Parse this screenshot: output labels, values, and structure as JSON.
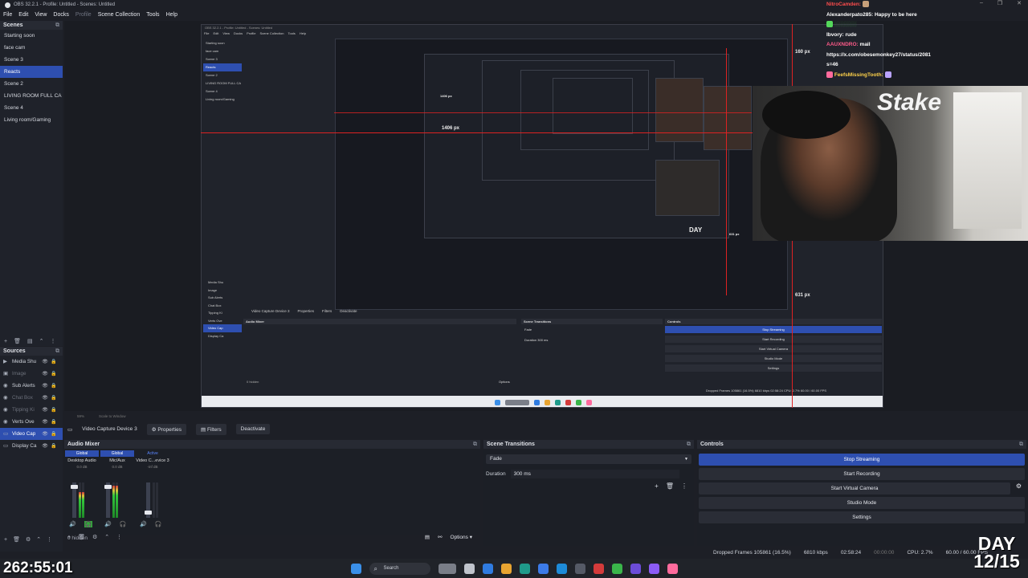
{
  "window": {
    "title": "OBS 32.2.1 - Profile: Untitled - Scenes: Untitled",
    "controls": [
      "–",
      "❐",
      "✕"
    ]
  },
  "menu": {
    "items": [
      "File",
      "Edit",
      "View",
      "Docks",
      "Profile",
      "Scene Collection",
      "Tools",
      "Help"
    ]
  },
  "scenes": {
    "title": "Scenes",
    "items": [
      "Starting soon",
      "face cam",
      "Scene 3",
      "Reacts",
      "Scene 2",
      "LIVING ROOM FULL CA",
      "Scene 4",
      "Living room/Gaming"
    ],
    "active_index": 3
  },
  "sources": {
    "title": "Sources",
    "items": [
      {
        "label": "Media Shu",
        "icon": "▶"
      },
      {
        "label": "Image",
        "icon": "▣"
      },
      {
        "label": "Sub Alerts",
        "icon": "◉"
      },
      {
        "label": "Chat Box",
        "icon": "◉"
      },
      {
        "label": "Tipping Ki",
        "icon": "◉"
      },
      {
        "label": "Verts Ove",
        "icon": "◉"
      },
      {
        "label": "Video Cap",
        "icon": "▭"
      },
      {
        "label": "Display Ca",
        "icon": "▭"
      }
    ],
    "hidden_label": "0 hidden"
  },
  "chat": {
    "messages": [
      {
        "user": "NitroCamden:",
        "text": "",
        "color": "user-red"
      },
      {
        "user": "Alexanderpato285:",
        "text": " Happy to be here",
        "color": "user-white"
      },
      {
        "user": "",
        "text": "",
        "color": "user-green"
      },
      {
        "user": "Ibvory:",
        "text": " rude",
        "color": "user-white"
      },
      {
        "user": "AAUXNDRO:",
        "text": " mail",
        "color": "user-pink"
      },
      {
        "user": "",
        "text": "https://x.com/obesemonkey27/status/2081",
        "color": "user-white"
      },
      {
        "user": "",
        "text": "s=46",
        "color": "user-white"
      },
      {
        "user": "FeefsMissingTooth:",
        "text": "",
        "color": "user-yellow"
      }
    ]
  },
  "webcam": {
    "brand": "Stake"
  },
  "nested": {
    "title": "OBS 32.2.1 - Profile: Untitled - Scenes: Untitled",
    "menu": [
      "File",
      "Edit",
      "View",
      "Docks",
      "Profile",
      "Scene Collection",
      "Tools",
      "Help"
    ],
    "scenes": [
      "Starting soon",
      "face cam",
      "Scene 3",
      "Reacts",
      "Scene 2",
      "LIVING ROOM FULL CA",
      "Scene 4",
      "Living room/Gaming"
    ],
    "sources": [
      "Media Shu",
      "Image",
      "Sub Alerts",
      "Chat Box",
      "Tipping Ki",
      "Verts Ove",
      "Video Cap",
      "Display Ca"
    ],
    "device_label": "Video Capture Device 3",
    "properties": "Properties",
    "filters": "Filters",
    "deactivate": "Deactivate",
    "audio_mixer": "Audio Mixer",
    "scene_transitions": "Scene Transitions",
    "controls": "Controls",
    "fade": "Fade",
    "duration": "Duration",
    "duration_value": "300 ms",
    "stop_streaming": "Stop Streaming",
    "start_recording": "Start Recording",
    "start_virtual_camera": "Start Virtual Camera",
    "studio_mode": "Studio Mode",
    "settings": "Settings",
    "hidden": "0 hidden",
    "options": "Options",
    "status": "Dropped Frames 105861 (16.5%)   6810 kbps   02:58:24   CPU: 2.7%   60.00 / 60.00 FPS",
    "measure_top": "160 px",
    "measure_left": "1406 px",
    "measure_right": "631 px",
    "inner_measure_left": "1406 px",
    "inner_measure_right": "631 px",
    "day_small": "DAY"
  },
  "below_preview": {
    "zoom": "59%",
    "scale": "Scale to Window"
  },
  "source_toolbar": {
    "device": "Video Capture Device 3",
    "properties": "Properties",
    "filters": "Filters",
    "deactivate": "Deactivate"
  },
  "audio_mixer": {
    "title": "Audio Mixer",
    "channels": [
      {
        "name": "Desktop Audio",
        "db": "0.0 dB",
        "tag": "Global",
        "level": 0.72
      },
      {
        "name": "Mic/Aux",
        "db": "0.0 dB",
        "tag": "Global",
        "level": 0.9
      },
      {
        "name": "Video C...evice 3",
        "db": "-inf dB",
        "tag": "Active",
        "level": 0.0
      }
    ],
    "options_label": "Options"
  },
  "scene_transitions": {
    "title": "Scene Transitions",
    "transition": "Fade",
    "duration_label": "Duration",
    "duration_value": "300 ms"
  },
  "controls": {
    "title": "Controls",
    "stop_streaming": "Stop Streaming",
    "start_recording": "Start Recording",
    "start_virtual_camera": "Start Virtual Camera",
    "studio_mode": "Studio Mode",
    "settings": "Settings"
  },
  "status": {
    "dropped_frames": "Dropped Frames 105861 (16.5%)",
    "bitrate": "6810 kbps",
    "stream_time": "02:58:24",
    "rec_time": "00:00:00",
    "cpu": "CPU: 2.7%",
    "fps": "60.00 / 60.00 FPS"
  },
  "taskbar": {
    "search": "Search",
    "icon_colors": [
      "#3a8fe8",
      "#7a7e88",
      "#c0c4cc",
      "#2f7be0",
      "#e8a431",
      "#1f9a8a",
      "#3c7be8",
      "#1d8bd8",
      "#d43b3b",
      "#3ab54a",
      "#6c4cd8",
      "#8b5cf6",
      "#ff6b9d"
    ]
  },
  "overlay": {
    "timer": "262:55:01",
    "day_label": "DAY",
    "day_count": "12/15"
  },
  "colors": {
    "accent": "#2e4fb0",
    "background": "#1d1f26",
    "guide_red": "#dd2222"
  }
}
